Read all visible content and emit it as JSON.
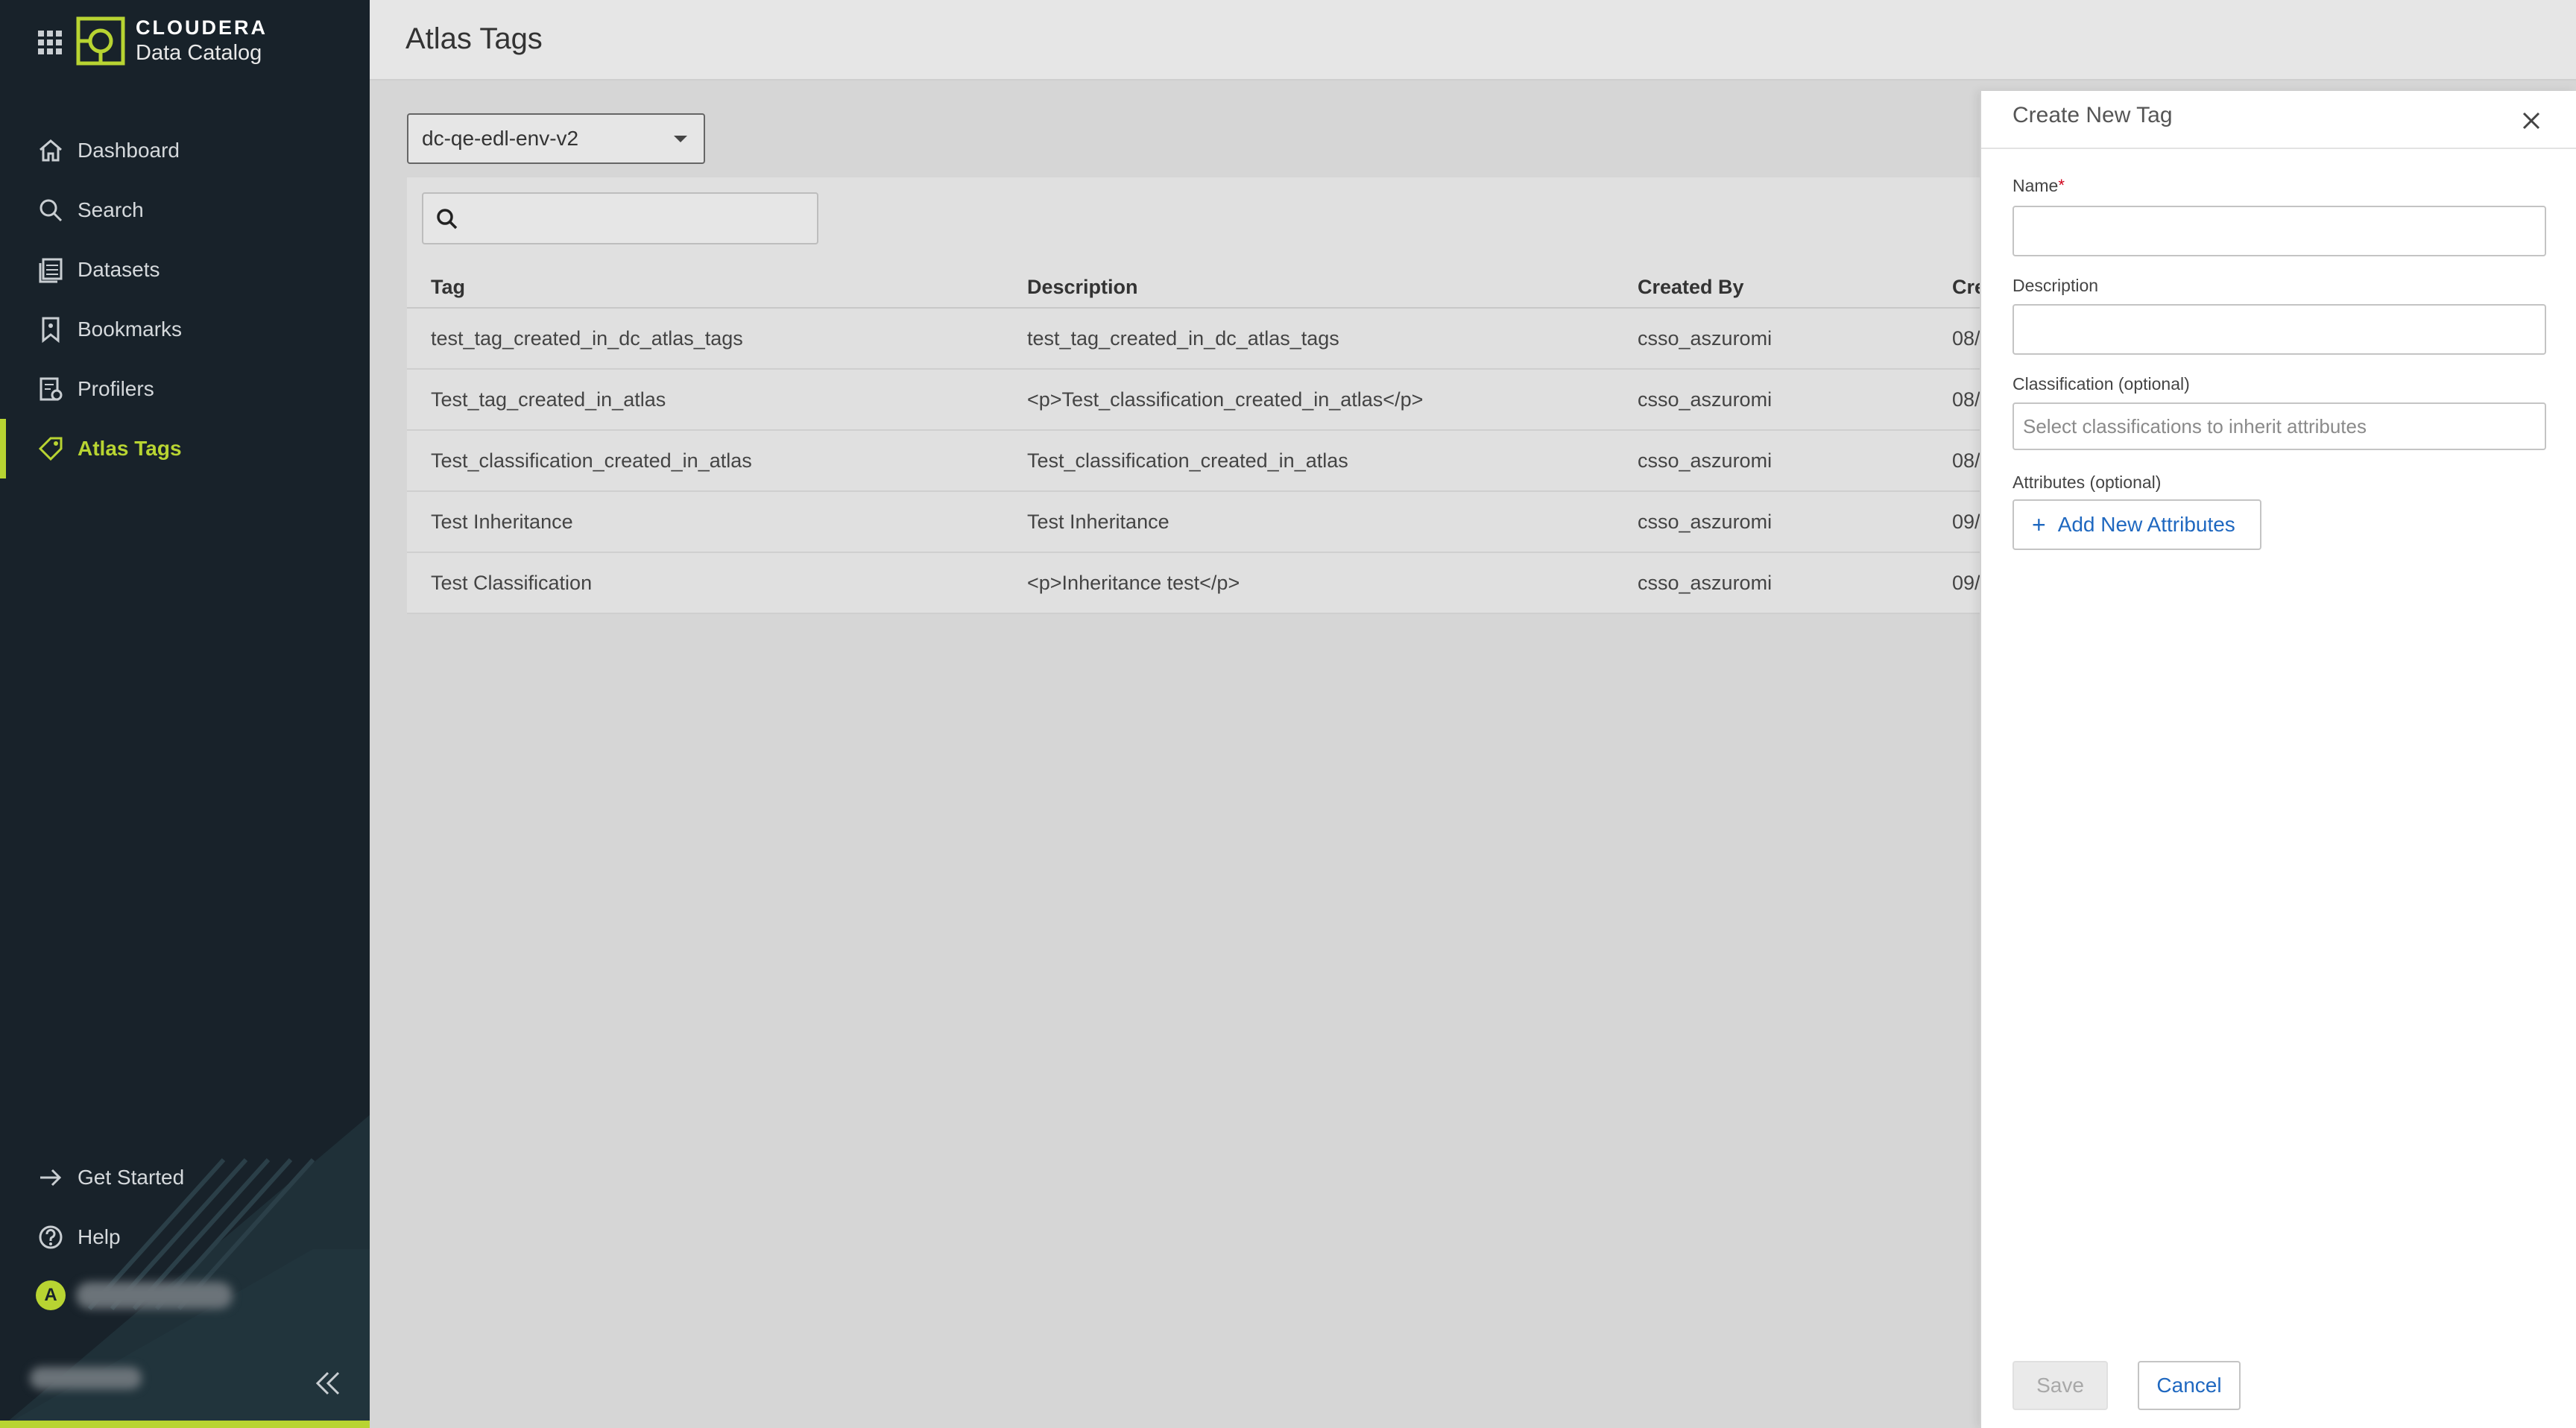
{
  "app": {
    "brand_name": "CLOUDERA",
    "product_name": "Data Catalog"
  },
  "sidebar": {
    "items": [
      {
        "label": "Dashboard",
        "icon": "home-icon"
      },
      {
        "label": "Search",
        "icon": "search-icon"
      },
      {
        "label": "Datasets",
        "icon": "datasets-icon"
      },
      {
        "label": "Bookmarks",
        "icon": "bookmark-icon"
      },
      {
        "label": "Profilers",
        "icon": "profilers-icon"
      },
      {
        "label": "Atlas Tags",
        "icon": "tag-icon",
        "active": true
      }
    ],
    "bottom_items": [
      {
        "label": "Get Started",
        "icon": "arrow-right-icon"
      },
      {
        "label": "Help",
        "icon": "help-circle-icon"
      }
    ],
    "user_initial": "A",
    "accent_color": "#b8d432"
  },
  "page": {
    "title": "Atlas Tags",
    "environment_selected": "dc-qe-edl-env-v2",
    "search_value": ""
  },
  "table": {
    "columns": [
      "Tag",
      "Description",
      "Created By",
      "Cre"
    ],
    "rows": [
      {
        "tag": "test_tag_created_in_dc_atlas_tags",
        "description": "test_tag_created_in_dc_atlas_tags",
        "created_by": "csso_aszuromi",
        "created": "08/"
      },
      {
        "tag": "Test_tag_created_in_atlas",
        "description": "<p>Test_classification_created_in_atlas</p>",
        "created_by": "csso_aszuromi",
        "created": "08/"
      },
      {
        "tag": "Test_classification_created_in_atlas",
        "description": "Test_classification_created_in_atlas",
        "created_by": "csso_aszuromi",
        "created": "08/"
      },
      {
        "tag": "Test Inheritance",
        "description": "Test Inheritance",
        "created_by": "csso_aszuromi",
        "created": "09/"
      },
      {
        "tag": "Test Classification",
        "description": "<p>Inheritance test</p>",
        "created_by": "csso_aszuromi",
        "created": "09/"
      }
    ]
  },
  "drawer": {
    "title": "Create New Tag",
    "name_label": "Name",
    "name_required_mark": "*",
    "name_value": "",
    "description_label": "Description",
    "description_value": "",
    "classification_label": "Classification (optional)",
    "classification_placeholder": "Select classifications to inherit attributes",
    "attributes_label": "Attributes (optional)",
    "add_attributes_label": "Add New Attributes",
    "add_attributes_icon": "+",
    "save_label": "Save",
    "cancel_label": "Cancel",
    "link_color": "#1f68c0"
  }
}
